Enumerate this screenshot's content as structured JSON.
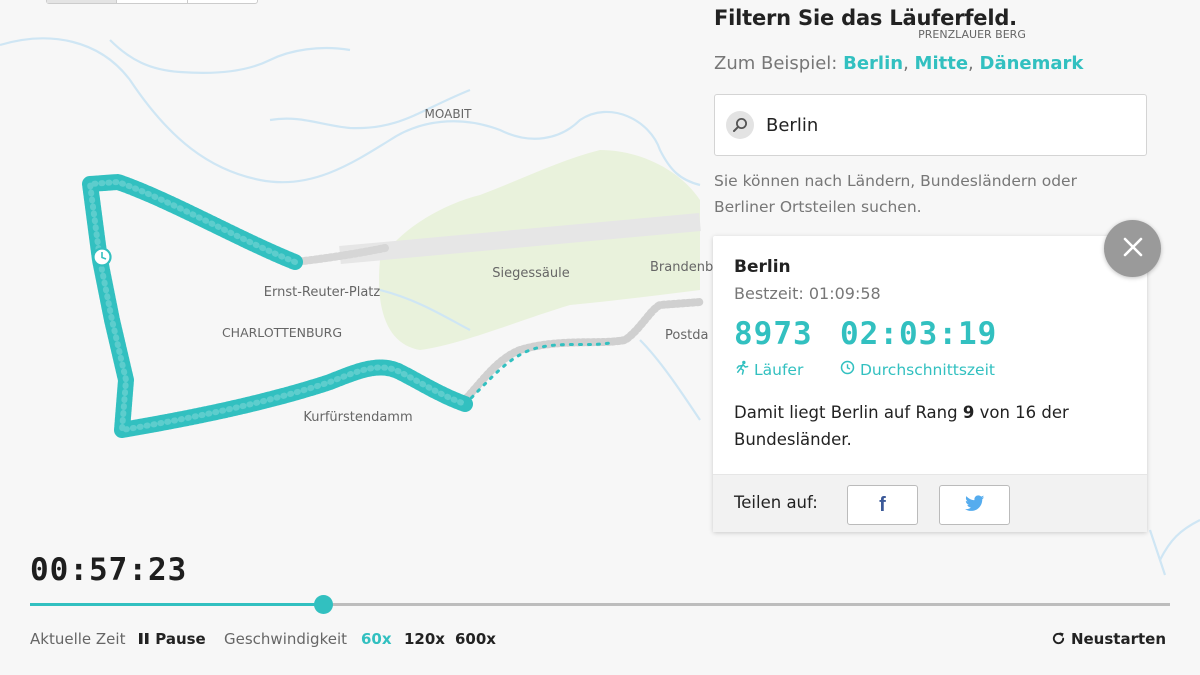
{
  "map": {
    "labels": {
      "moabit": "MOABIT",
      "prenzlauer_berg": "PRENZLAUER BERG",
      "siegessaeule": "Siegessäule",
      "brandenburg": "Brandenb",
      "ernst_reuter": "Ernst-Reuter-Platz",
      "charlottenburg": "CHARLOTTENBURG",
      "potsdam": "Postda",
      "kurfuerstendamm": "Kurfürstendamm"
    },
    "colors": {
      "runners": "#32c0c0",
      "water": "#c9e3f2",
      "park": "#e6f1d6",
      "road": "#e2e2e2"
    }
  },
  "filter": {
    "heading": "Filtern Sie das Läuferfeld.",
    "examples_prefix": "Zum Beispiel:",
    "examples": [
      "Berlin",
      "Mitte",
      "Dänemark"
    ],
    "search_value": "Berlin",
    "hint": "Sie können nach Ländern, Bundesländern oder Berliner Ortsteilen suchen."
  },
  "result_card": {
    "title": "Berlin",
    "best_time": "Bestzeit: 01:09:58",
    "runners_count": "8973",
    "runners_label": "Läufer",
    "avg_time": "02:03:19",
    "avg_label": "Durchschnittszeit",
    "rank_prefix": "Damit liegt Berlin auf Rang",
    "rank_value": "9",
    "rank_suffix": "von 16 der Bundesländer.",
    "share_label": "Teilen auf:",
    "facebook_glyph": "f"
  },
  "playback": {
    "clock": "00:57:23",
    "progress": 0.257,
    "current_time_label": "Aktuelle Zeit",
    "pause_label": "Pause",
    "speed_label": "Geschwindigkeit",
    "speeds": [
      "60x",
      "120x",
      "600x"
    ],
    "active_speed": "60x",
    "restart_label": "Neustarten"
  }
}
